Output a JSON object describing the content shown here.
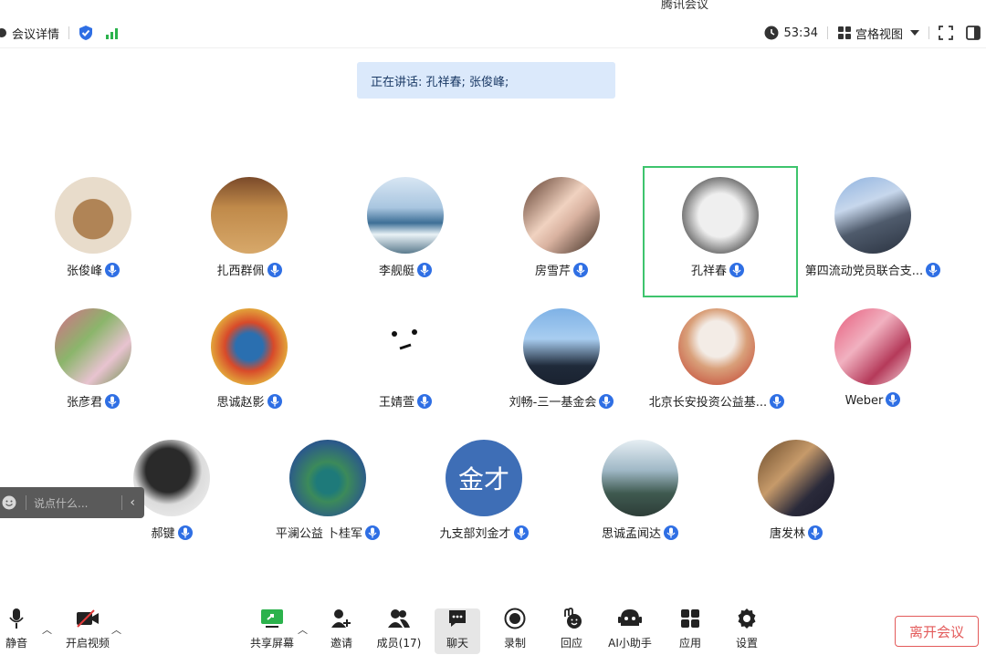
{
  "app": {
    "title": "腾讯会议"
  },
  "topbar": {
    "meeting_details": "会议详情",
    "timer": "53:34",
    "view_mode": "宫格视图"
  },
  "banner": {
    "speaking": "正在讲话: 孔祥春; 张俊峰;"
  },
  "participants": [
    {
      "name": "张俊峰"
    },
    {
      "name": "扎西群佩"
    },
    {
      "name": "李舰艇"
    },
    {
      "name": "房雪芹"
    },
    {
      "name": "孔祥春"
    },
    {
      "name": "第四流动党员联合支..."
    },
    {
      "name": "张彦君"
    },
    {
      "name": "思诚赵影"
    },
    {
      "name": "王婧萱"
    },
    {
      "name": "刘畅-三一基金会"
    },
    {
      "name": "北京长安投资公益基..."
    },
    {
      "name": "Weber"
    },
    {
      "name": "郝键"
    },
    {
      "name": "平澜公益 卜桂军"
    },
    {
      "name": "九支部刘金才",
      "avatar_text": "金才"
    },
    {
      "name": "思诚孟闻达"
    },
    {
      "name": "唐发林"
    }
  ],
  "chat": {
    "placeholder": "说点什么..."
  },
  "toolbar": {
    "mute": "静音",
    "video": "开启视频",
    "share": "共享屏幕",
    "invite": "邀请",
    "members": "成员(17)",
    "chat": "聊天",
    "record": "录制",
    "react": "回应",
    "ai": "AI小助手",
    "apps": "应用",
    "settings": "设置",
    "leave": "离开会议"
  },
  "colors": {
    "accent": "#2f6fe4",
    "active_speaker_border": "#3ec46d",
    "leave": "#e35a5a",
    "banner_bg": "#dbe9fb"
  }
}
